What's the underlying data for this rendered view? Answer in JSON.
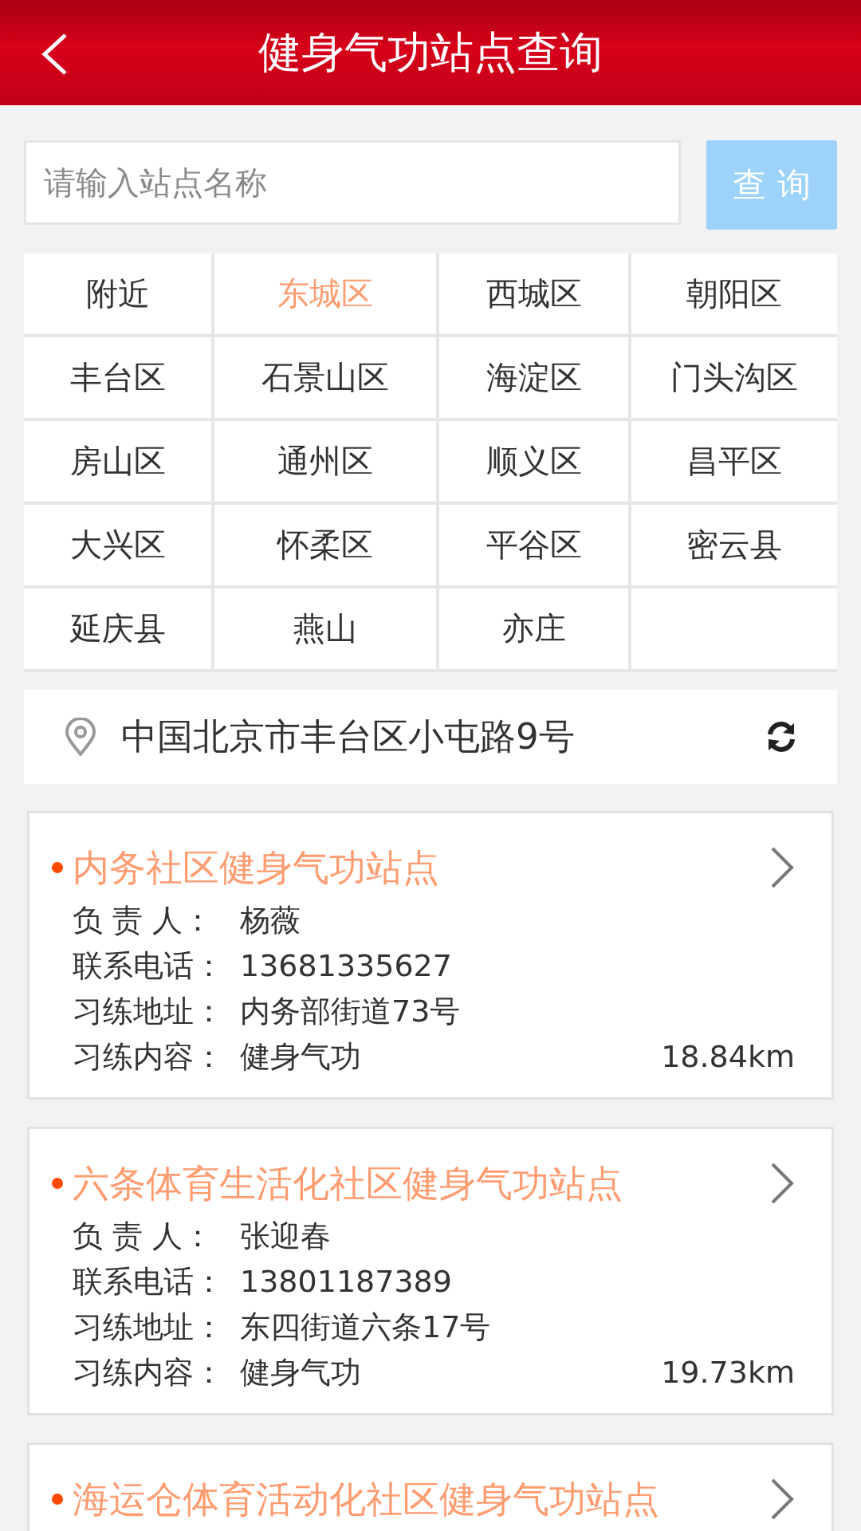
{
  "header": {
    "title": "健身气功站点查询"
  },
  "search": {
    "placeholder": "请输入站点名称",
    "button": "查 询"
  },
  "districts": [
    {
      "label": "附近",
      "selected": false
    },
    {
      "label": "东城区",
      "selected": true
    },
    {
      "label": "西城区",
      "selected": false
    },
    {
      "label": "朝阳区",
      "selected": false
    },
    {
      "label": "丰台区",
      "selected": false
    },
    {
      "label": "石景山区",
      "selected": false
    },
    {
      "label": "海淀区",
      "selected": false
    },
    {
      "label": "门头沟区",
      "selected": false
    },
    {
      "label": "房山区",
      "selected": false
    },
    {
      "label": "通州区",
      "selected": false
    },
    {
      "label": "顺义区",
      "selected": false
    },
    {
      "label": "昌平区",
      "selected": false
    },
    {
      "label": "大兴区",
      "selected": false
    },
    {
      "label": "怀柔区",
      "selected": false
    },
    {
      "label": "平谷区",
      "selected": false
    },
    {
      "label": "密云县",
      "selected": false
    },
    {
      "label": "延庆县",
      "selected": false
    },
    {
      "label": "燕山",
      "selected": false
    },
    {
      "label": "亦庄",
      "selected": false
    }
  ],
  "location": {
    "address": "中国北京市丰台区小屯路9号"
  },
  "stations": [
    {
      "name": "内务社区健身气功站点",
      "details": [
        {
          "label": "负 责 人：",
          "value": "杨薇"
        },
        {
          "label": "联系电话：",
          "value": "13681335627"
        },
        {
          "label": "习练地址：",
          "value": "内务部街道73号"
        },
        {
          "label": "习练内容：",
          "value": "健身气功"
        }
      ],
      "distance": "18.84km"
    },
    {
      "name": "六条体育生活化社区健身气功站点",
      "details": [
        {
          "label": "负 责 人：",
          "value": "张迎春"
        },
        {
          "label": "联系电话：",
          "value": "13801187389"
        },
        {
          "label": "习练地址：",
          "value": "东四街道六条17号"
        },
        {
          "label": "习练内容：",
          "value": "健身气功"
        }
      ],
      "distance": "19.73km"
    },
    {
      "name": "海运仓体育活动化社区健身气功站点"
    }
  ]
}
